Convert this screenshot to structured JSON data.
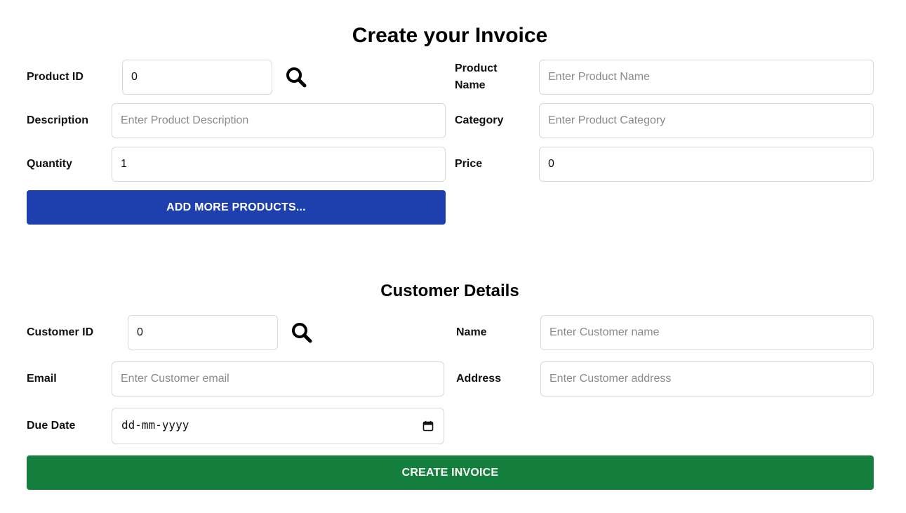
{
  "invoice": {
    "title": "Create your Invoice",
    "product_id": {
      "label": "Product ID",
      "value": "0"
    },
    "product_name": {
      "label": "Product Name",
      "placeholder": "Enter Product Name",
      "value": ""
    },
    "description": {
      "label": "Description",
      "placeholder": "Enter Product Description",
      "value": ""
    },
    "category": {
      "label": "Category",
      "placeholder": "Enter Product Category",
      "value": ""
    },
    "quantity": {
      "label": "Quantity",
      "value": "1"
    },
    "price": {
      "label": "Price",
      "value": "0"
    },
    "add_more_label": "ADD MORE PRODUCTS..."
  },
  "customer": {
    "title": "Customer Details",
    "customer_id": {
      "label": "Customer ID",
      "value": "0"
    },
    "name": {
      "label": "Name",
      "placeholder": "Enter Customer name",
      "value": ""
    },
    "email": {
      "label": "Email",
      "placeholder": "Enter Customer email",
      "value": ""
    },
    "address": {
      "label": "Address",
      "placeholder": "Enter Customer address",
      "value": ""
    },
    "due_date": {
      "label": "Due Date",
      "placeholder": "dd-mm-yyyy"
    },
    "create_label": "CREATE INVOICE"
  },
  "icons": {
    "product_search": "search-icon",
    "customer_search": "search-icon",
    "calendar": "calendar-icon"
  },
  "colors": {
    "primary_button": "#1e40af",
    "create_button": "#15803d",
    "border": "#d9d9d9"
  }
}
